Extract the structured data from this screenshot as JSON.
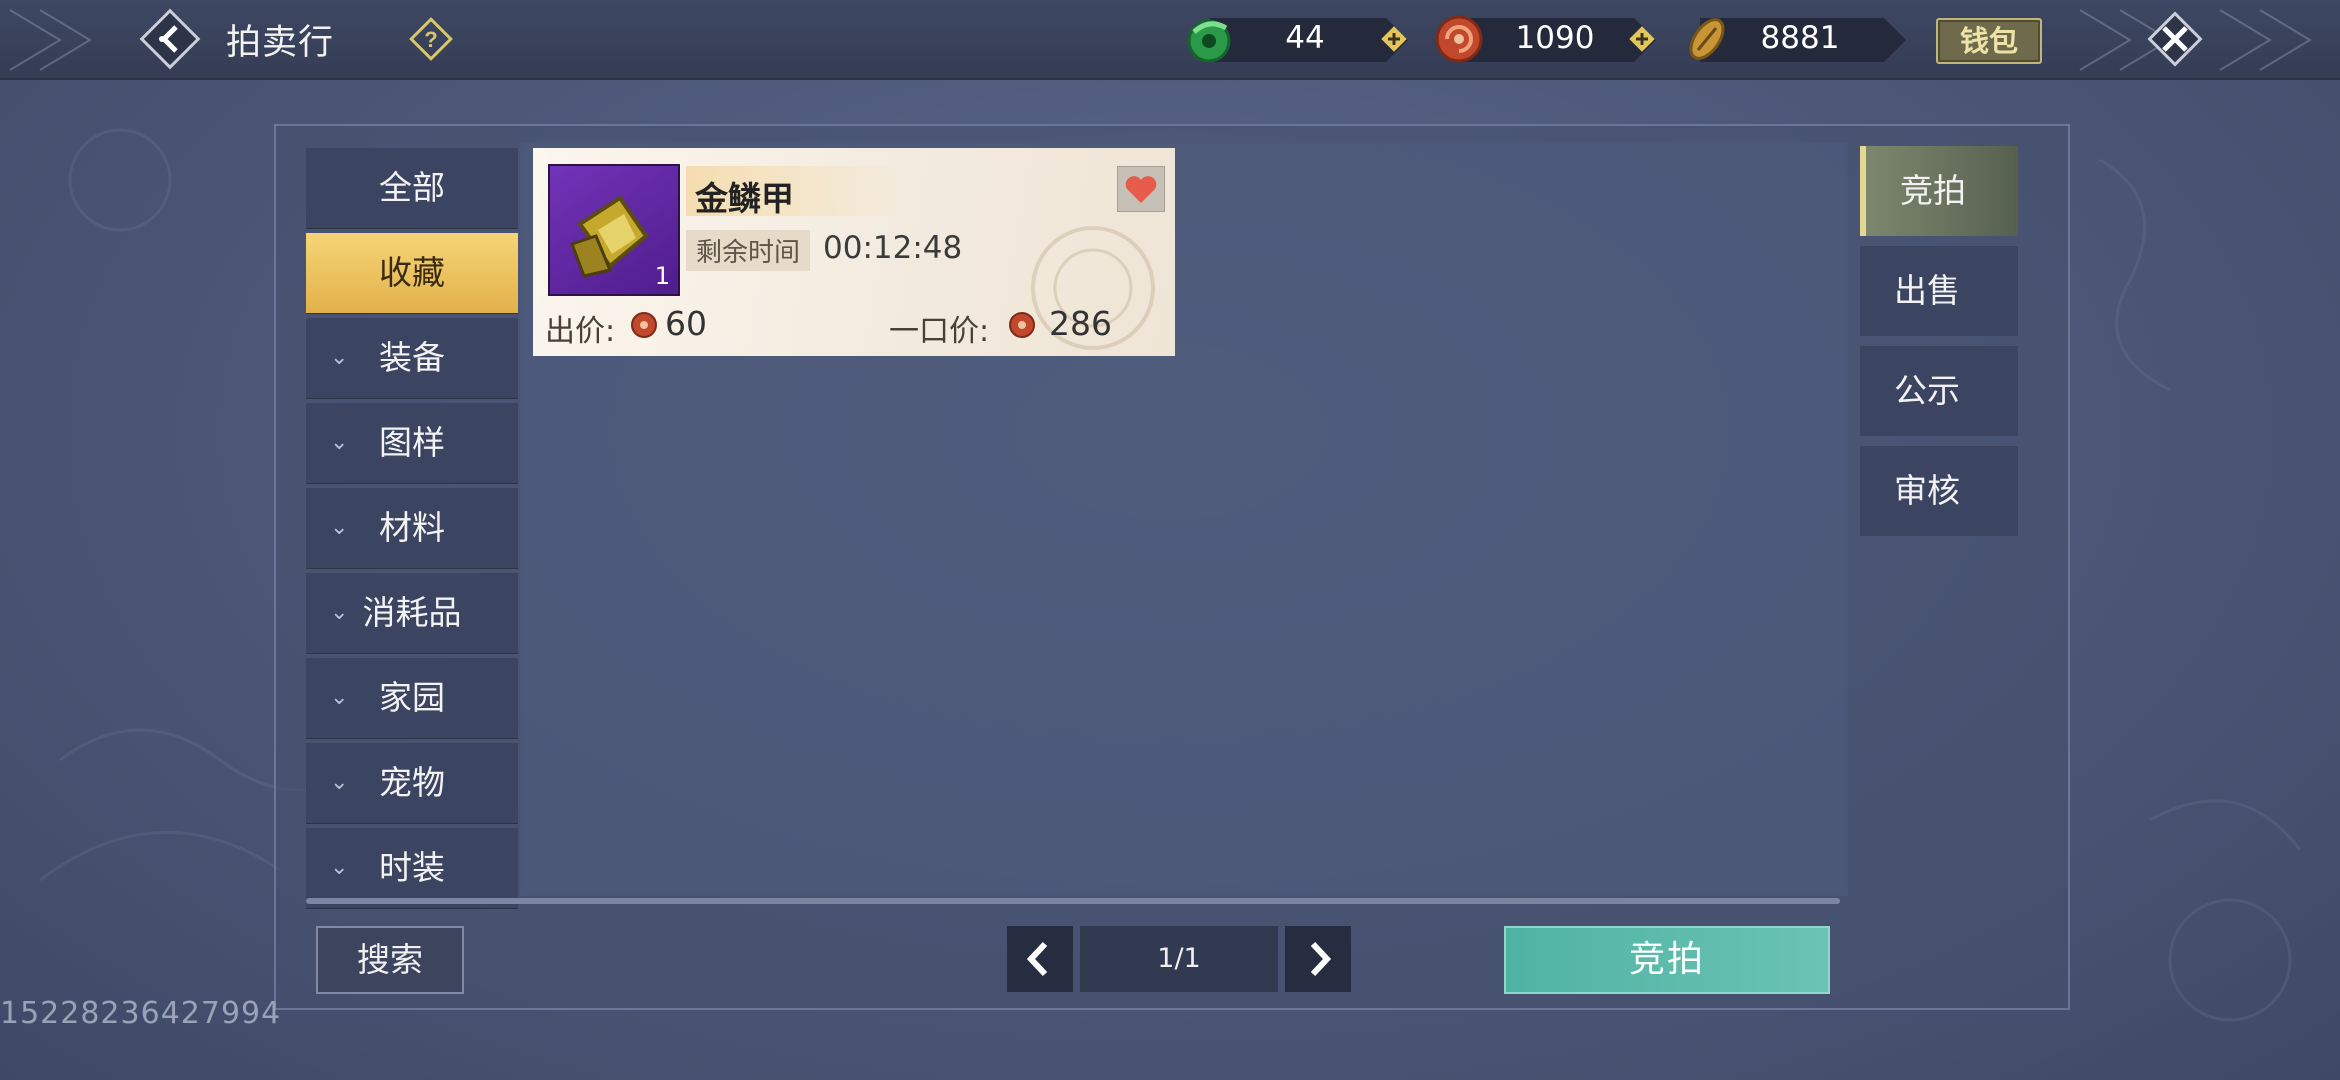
{
  "header": {
    "title": "拍卖行",
    "currencies": [
      {
        "icon": "jade-coin-icon",
        "value": "44",
        "has_plus": true
      },
      {
        "icon": "copper-coin-icon",
        "value": "1090",
        "has_plus": true
      },
      {
        "icon": "shell-coin-icon",
        "value": "8881",
        "has_plus": false
      }
    ],
    "wallet_label": "钱包"
  },
  "categories": [
    {
      "label": "全部",
      "active": false,
      "expandable": false
    },
    {
      "label": "收藏",
      "active": true,
      "expandable": false
    },
    {
      "label": "装备",
      "active": false,
      "expandable": true
    },
    {
      "label": "图样",
      "active": false,
      "expandable": true
    },
    {
      "label": "材料",
      "active": false,
      "expandable": true
    },
    {
      "label": "消耗品",
      "active": false,
      "expandable": true
    },
    {
      "label": "家园",
      "active": false,
      "expandable": true
    },
    {
      "label": "宠物",
      "active": false,
      "expandable": true
    },
    {
      "label": "时装",
      "active": false,
      "expandable": true
    }
  ],
  "listing": {
    "name": "金鳞甲",
    "count": "1",
    "remain_label": "剩余时间",
    "remain_time": "00:12:48",
    "bid_label": "出价:",
    "bid_value": "60",
    "buyout_label": "一口价:",
    "buyout_value": "286",
    "favorited": true
  },
  "side_tabs": [
    {
      "label": "竞拍",
      "active": true
    },
    {
      "label": "出售",
      "active": false
    },
    {
      "label": "公示",
      "active": false
    },
    {
      "label": "审核",
      "active": false
    }
  ],
  "bottom": {
    "search_label": "搜索",
    "page": "1/1",
    "action_label": "竞拍"
  },
  "uid": "15228236427994",
  "colors": {
    "accent_gold": "#e8bd55",
    "action_teal": "#5dbcad",
    "favorite_red": "#e65b4a"
  }
}
